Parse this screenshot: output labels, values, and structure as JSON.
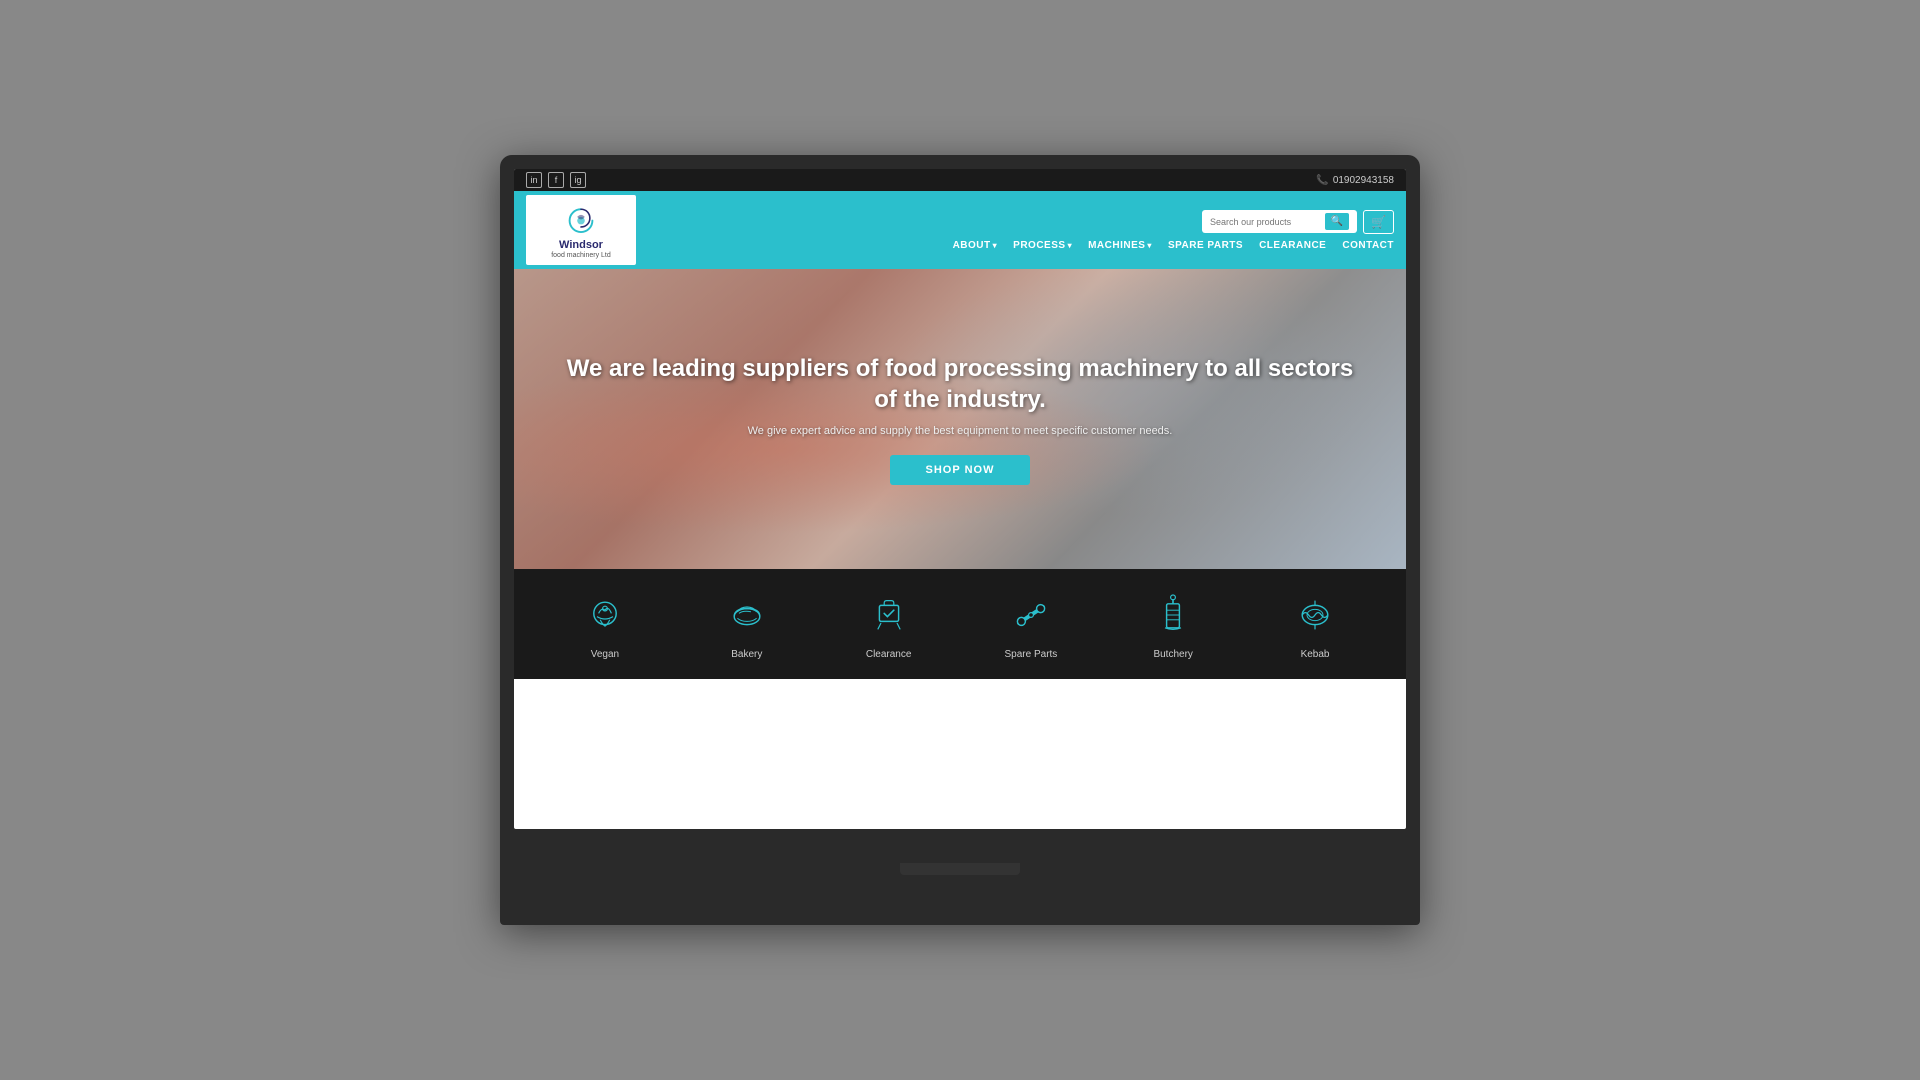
{
  "site": {
    "company_name": "Windsor",
    "company_subname": "food machinery Ltd",
    "phone": "01902943158",
    "tagline": "We are leading suppliers of food processing machinery to all sectors of the industry.",
    "subtitle": "We give expert advice and supply the best equipment to meet specific customer needs.",
    "cta_button": "SHOP NOW",
    "search_placeholder": "Search our products"
  },
  "social": {
    "linkedin": "in",
    "facebook": "f",
    "instagram": "ig"
  },
  "nav": {
    "items": [
      {
        "label": "ABOUT",
        "has_dropdown": true
      },
      {
        "label": "PROCESS",
        "has_dropdown": true
      },
      {
        "label": "MACHINES",
        "has_dropdown": true
      },
      {
        "label": "SPARE PARTS",
        "has_dropdown": false
      },
      {
        "label": "CLEARANCE",
        "has_dropdown": false
      },
      {
        "label": "CONTACT",
        "has_dropdown": false
      }
    ]
  },
  "categories": [
    {
      "label": "Vegan",
      "icon": "vegan-icon"
    },
    {
      "label": "Bakery",
      "icon": "bakery-icon"
    },
    {
      "label": "Clearance",
      "icon": "clearance-icon"
    },
    {
      "label": "Spare Parts",
      "icon": "spare-parts-icon"
    },
    {
      "label": "Butchery",
      "icon": "butchery-icon"
    },
    {
      "label": "Kebab",
      "icon": "kebab-icon"
    }
  ],
  "colors": {
    "teal": "#2bbfcc",
    "dark": "#1a1a1a",
    "white": "#ffffff"
  }
}
